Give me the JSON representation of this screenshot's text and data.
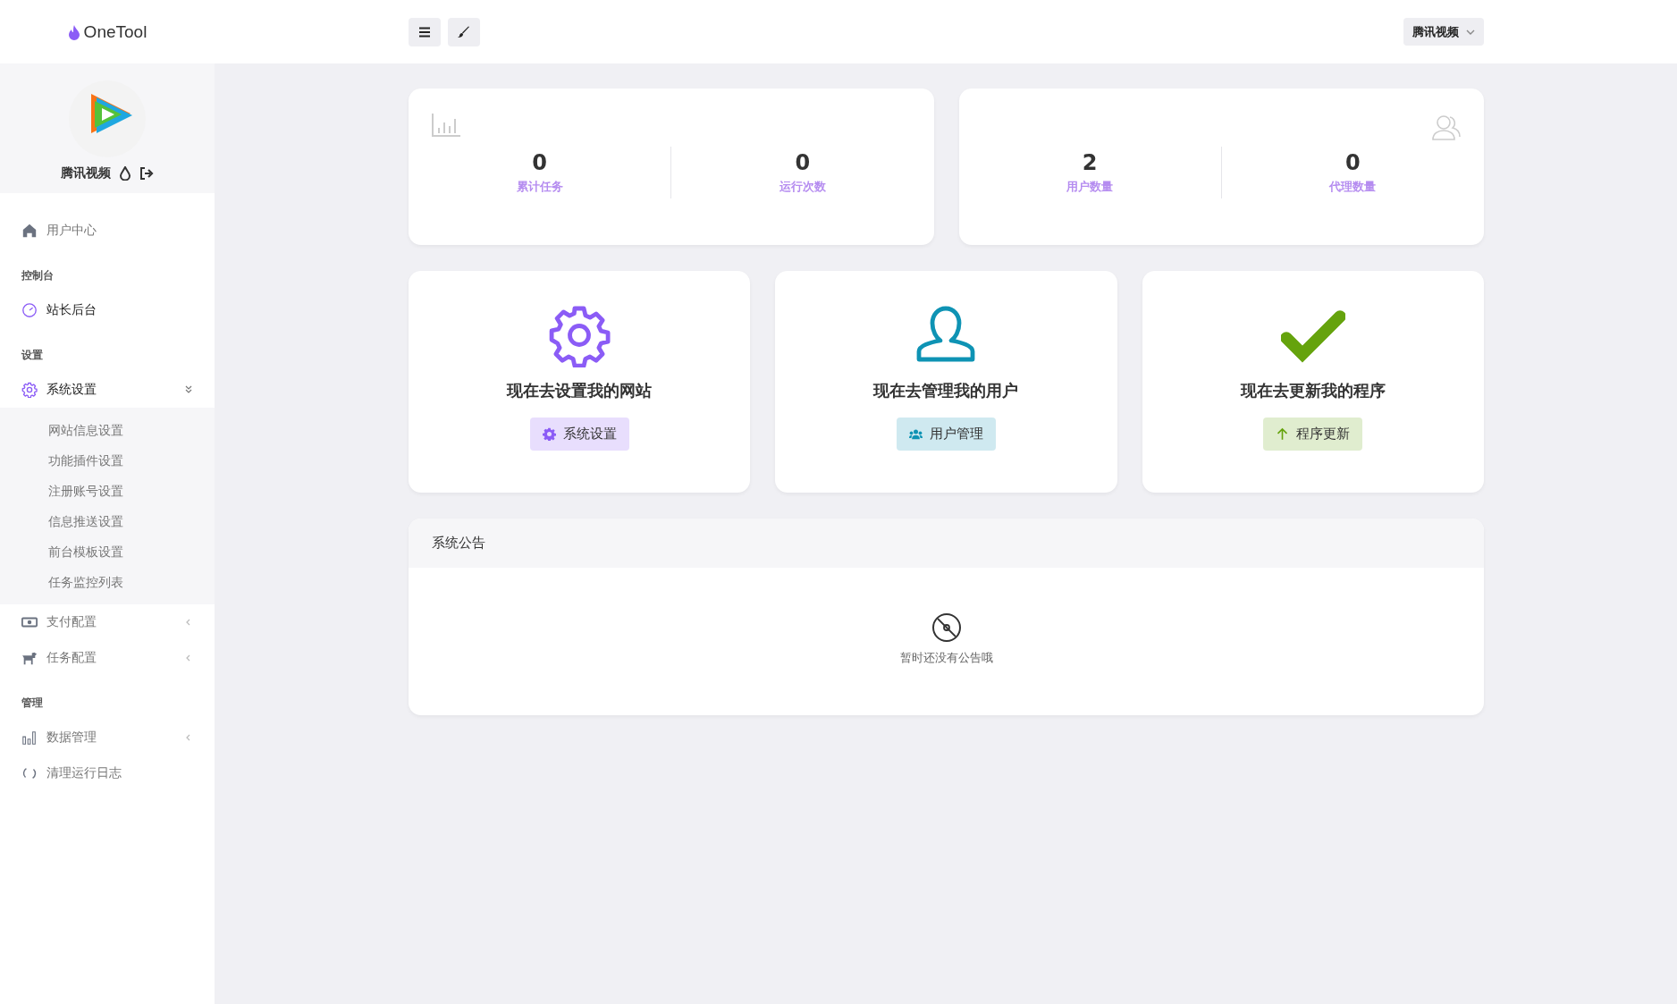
{
  "header": {
    "brand": "OneTool",
    "site_menu": {
      "label": "腾讯视频",
      "expanded": false
    }
  },
  "sidebar": {
    "profile": {
      "name": "腾讯视频"
    },
    "sections": [
      {
        "items": [
          {
            "label": "用户中心",
            "active": false
          }
        ]
      },
      {
        "heading": "控制台",
        "items": [
          {
            "label": "站长后台",
            "active": true
          }
        ]
      },
      {
        "heading": "设置",
        "items": [
          {
            "label": "系统设置",
            "active": true,
            "expanded": true,
            "children": [
              {
                "label": "网站信息设置"
              },
              {
                "label": "功能插件设置"
              },
              {
                "label": "注册账号设置"
              },
              {
                "label": "信息推送设置"
              },
              {
                "label": "前台模板设置"
              },
              {
                "label": "任务监控列表"
              }
            ]
          },
          {
            "label": "支付配置",
            "active": false,
            "expanded": false
          },
          {
            "label": "任务配置",
            "active": false,
            "expanded": false
          }
        ]
      },
      {
        "heading": "管理",
        "items": [
          {
            "label": "数据管理",
            "active": false,
            "expanded": false
          },
          {
            "label": "清理运行日志",
            "active": false
          }
        ]
      }
    ]
  },
  "stat_cards": [
    {
      "stats": [
        {
          "value": "0",
          "label": "累计任务"
        },
        {
          "value": "0",
          "label": "运行次数"
        }
      ]
    },
    {
      "stats": [
        {
          "value": "2",
          "label": "用户数量"
        },
        {
          "value": "0",
          "label": "代理数量"
        }
      ]
    }
  ],
  "action_cards": [
    {
      "title": "现在去设置我的网站",
      "button": "系统设置",
      "color": "#8b5cf6"
    },
    {
      "title": "现在去管理我的用户",
      "button": "用户管理",
      "color": "#0e93b4"
    },
    {
      "title": "现在去更新我的程序",
      "button": "程序更新",
      "color": "#65a30d"
    }
  ],
  "notice": {
    "title": "系统公告",
    "empty_text": "暂时还没有公告哦"
  }
}
